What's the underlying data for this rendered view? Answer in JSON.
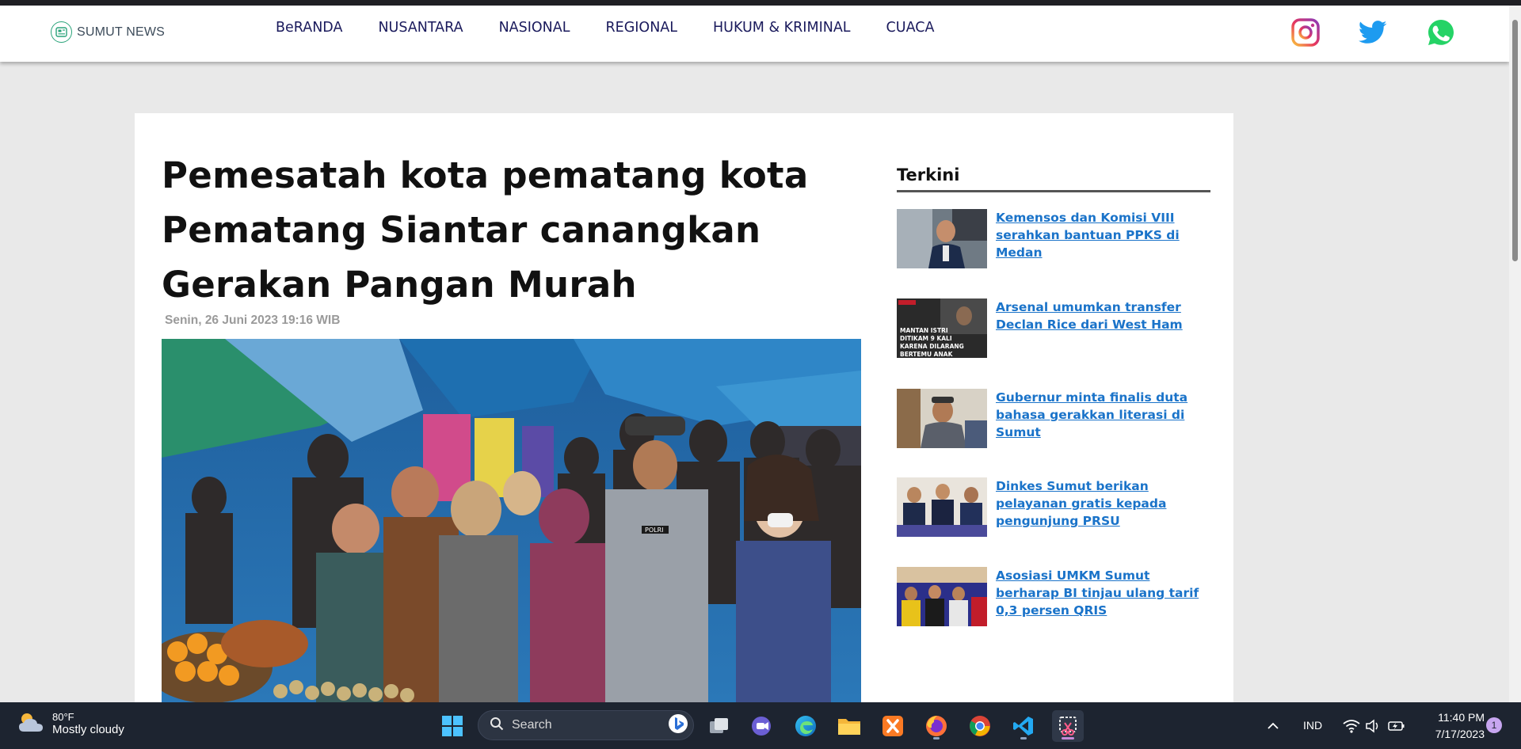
{
  "brand": {
    "name": "SUMUT NEWS"
  },
  "nav": {
    "links": [
      "BeRANDA",
      "NUSANTARA",
      "NASIONAL",
      "REGIONAL",
      "HUKUM & KRIMINAL",
      "CUACA"
    ]
  },
  "social": [
    "instagram-icon",
    "twitter-icon",
    "whatsapp-icon"
  ],
  "article": {
    "title": "Pemesatah kota pematang kota Pematang Siantar canangkan Gerakan Pangan Murah",
    "date": "Senin, 26 Juni 2023 19:16 WIB",
    "image_badge": "POLRI"
  },
  "sidebar": {
    "title": "Terkini",
    "items": [
      {
        "title": "Kemensos dan Komisi VIII serahkan bantuan PPKS di Medan"
      },
      {
        "title": "Arsenal umumkan transfer Declan Rice dari West Ham",
        "thumb_caption": "MANTAN ISTRI DITIKAM 9 KALI KARENA DILARANG BERTEMU ANAK"
      },
      {
        "title": "Gubernur minta finalis duta bahasa gerakkan literasi di Sumut"
      },
      {
        "title": "Dinkes Sumut berikan pelayanan gratis kepada pengunjung PRSU"
      },
      {
        "title": "Asosiasi UMKM Sumut berharap BI tinjau ulang tarif 0,3 persen QRIS"
      }
    ]
  },
  "taskbar": {
    "weather": {
      "temp": "80°F",
      "desc": "Mostly cloudy"
    },
    "search_label": "Search",
    "apps": [
      "windows-start-icon",
      "task-view-icon",
      "meet-icon",
      "edge-icon",
      "file-explorer-icon",
      "xampp-icon",
      "firefox-icon",
      "chrome-icon",
      "vscode-icon",
      "snipping-tool-icon"
    ],
    "tray": {
      "language": "IND",
      "time": "11:40 PM",
      "date": "7/17/2023",
      "notifications": "1"
    }
  },
  "colors": {
    "nav_text": "#1a1a5c",
    "link_blue": "#1a73c9",
    "taskbar_bg": "#1d2430",
    "page_bg": "#e9e9e9"
  }
}
